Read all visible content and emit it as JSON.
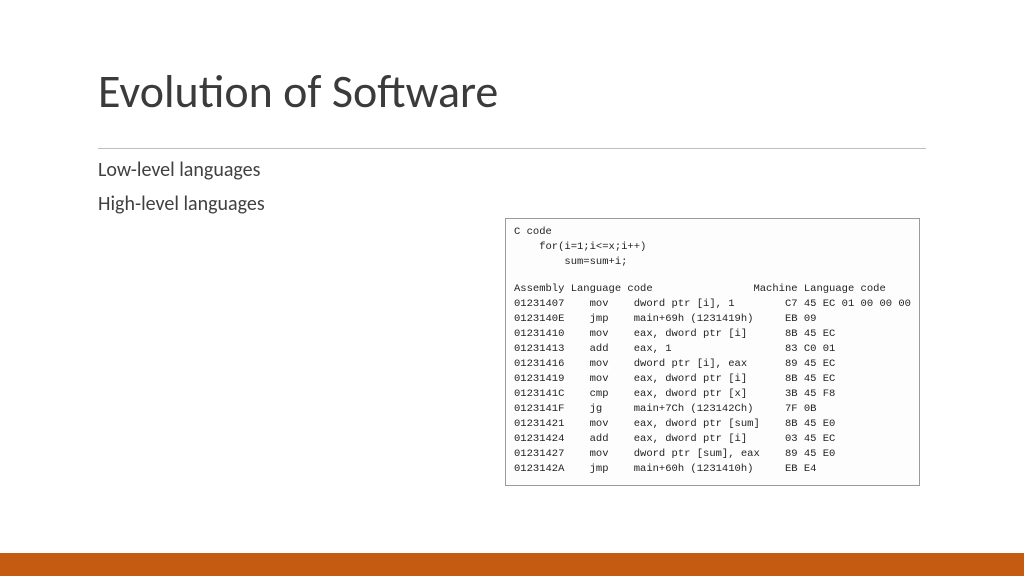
{
  "title": "Evolution of Software",
  "bullets": {
    "b1": "Low-level languages",
    "b2": "High-level languages"
  },
  "code": {
    "c_header": "C code",
    "c_line1": "    for(i=1;i<=x;i++)",
    "c_line2": "        sum=sum+i;",
    "asm_header": "Assembly Language code                Machine Language code",
    "rows": [
      "01231407    mov    dword ptr [i], 1        C7 45 EC 01 00 00 00",
      "0123140E    jmp    main+69h (1231419h)     EB 09",
      "01231410    mov    eax, dword ptr [i]      8B 45 EC",
      "01231413    add    eax, 1                  83 C0 01",
      "01231416    mov    dword ptr [i], eax      89 45 EC",
      "01231419    mov    eax, dword ptr [i]      8B 45 EC",
      "0123141C    cmp    eax, dword ptr [x]      3B 45 F8",
      "0123141F    jg     main+7Ch (123142Ch)     7F 0B",
      "01231421    mov    eax, dword ptr [sum]    8B 45 E0",
      "01231424    add    eax, dword ptr [i]      03 45 EC",
      "01231427    mov    dword ptr [sum], eax    89 45 E0",
      "0123142A    jmp    main+60h (1231410h)     EB E4"
    ]
  }
}
